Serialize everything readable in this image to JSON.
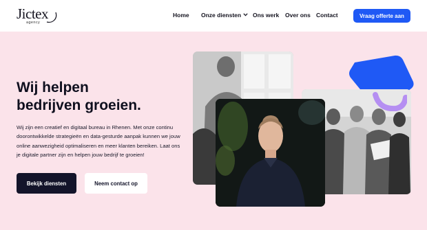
{
  "header": {
    "logo_text": "Jictex",
    "logo_sub": "agency",
    "nav": {
      "home": "Home",
      "diensten": "Onze diensten",
      "werk": "Ons werk",
      "over": "Over ons",
      "contact": "Contact"
    },
    "cta_label": "Vraag offerte aan"
  },
  "hero": {
    "title_line1": "Wij helpen",
    "title_line2": "bedrijven groeien.",
    "body": "Wij zijn een creatief en digitaal bureau in Rhenen. Met onze continu doorontwikkelde strategieën en data-gesturde aanpak kunnen we jouw online aanwezigheid optimaliseren en meer klanten bereiken. Laat ons je digitale partner zijn en helpen jouw bedrijf te groeien!",
    "primary_button": "Bekijk diensten",
    "secondary_button": "Neem contact op"
  },
  "colors": {
    "accent_blue": "#1f59f5",
    "hero_background": "#fbe3ea",
    "dark_button": "#13142a",
    "accent_purple": "#b58ff2"
  },
  "icons": {
    "dropdown": "chevron-down-icon"
  }
}
